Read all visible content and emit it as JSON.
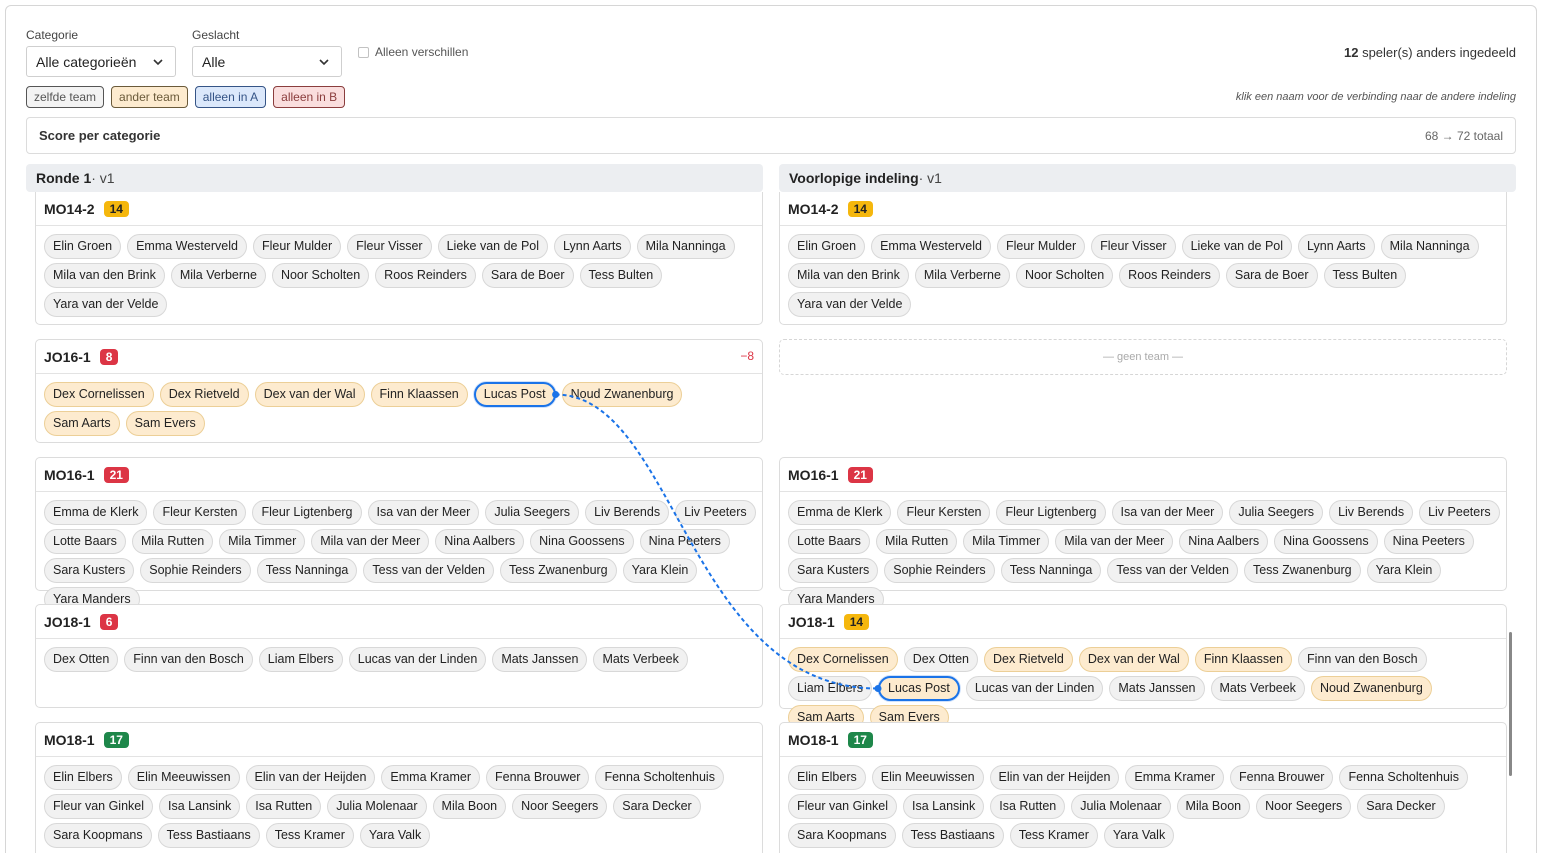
{
  "filters": {
    "category_label": "Categorie",
    "category_value": "Alle categorieën",
    "gender_label": "Geslacht",
    "gender_value": "Alle",
    "only_diff_label": "Alleen verschillen"
  },
  "summary": {
    "count": "12",
    "text": "speler(s) anders ingedeeld"
  },
  "legend": {
    "same": "zelfde team",
    "other": "ander team",
    "only_a": "alleen in A",
    "only_b": "alleen in B"
  },
  "hint": "klik een naam voor de verbinding naar de andere indeling",
  "score": {
    "title": "Score per categorie",
    "total": "68 → 72 totaal"
  },
  "colors": {
    "moved": "#fdebcf",
    "selected": "#1a73e8",
    "yellow": "#f5b70d",
    "red": "#dc3545",
    "green": "#1e874a"
  },
  "left": {
    "title": "Ronde 1",
    "version": " · v1",
    "mo14": {
      "name": "MO14-2",
      "score": "14",
      "players": [
        "Elin Groen",
        "Emma Westerveld",
        "Fleur Mulder",
        "Fleur Visser",
        "Lieke van de Pol",
        "Lynn Aarts",
        "Mila Nanninga",
        "Mila van den Brink",
        "Mila Verberne",
        "Noor Scholten",
        "Roos Reinders",
        "Sara de Boer",
        "Tess Bulten",
        "Yara van der Velde"
      ]
    },
    "jo16": {
      "name": "JO16-1",
      "score": "8",
      "delta": "−8",
      "players": [
        "Dex Cornelissen",
        "Dex Rietveld",
        "Dex van der Wal",
        "Finn Klaassen",
        "Lucas Post",
        "Noud Zwanenburg",
        "Sam Aarts",
        "Sam Evers"
      ]
    },
    "mo16": {
      "name": "MO16-1",
      "score": "21",
      "players": [
        "Emma de Klerk",
        "Fleur Kersten",
        "Fleur Ligtenberg",
        "Isa van der Meer",
        "Julia Seegers",
        "Liv Berends",
        "Liv Peeters",
        "Lotte Baars",
        "Mila Rutten",
        "Mila Timmer",
        "Mila van der Meer",
        "Nina Aalbers",
        "Nina Goossens",
        "Nina Peeters",
        "Sara Kusters",
        "Sophie Reinders",
        "Tess Nanninga",
        "Tess van der Velden",
        "Tess Zwanenburg",
        "Yara Klein",
        "Yara Manders"
      ]
    },
    "jo18": {
      "name": "JO18-1",
      "score": "6",
      "players": [
        "Dex Otten",
        "Finn van den Bosch",
        "Liam Elbers",
        "Lucas van der Linden",
        "Mats Janssen",
        "Mats Verbeek"
      ]
    },
    "mo18": {
      "name": "MO18-1",
      "score": "17",
      "players": [
        "Elin Elbers",
        "Elin Meeuwissen",
        "Elin van der Heijden",
        "Emma Kramer",
        "Fenna Brouwer",
        "Fenna Scholtenhuis",
        "Fleur van Ginkel",
        "Isa Lansink",
        "Isa Rutten",
        "Julia Molenaar",
        "Mila Boon",
        "Noor Seegers",
        "Sara Decker",
        "Sara Koopmans",
        "Tess Bastiaans",
        "Tess Kramer",
        "Yara Valk"
      ]
    }
  },
  "right": {
    "title": "Voorlopige indeling",
    "version": " · v1",
    "empty_text": "— geen team —",
    "mo14": {
      "name": "MO14-2",
      "score": "14",
      "players": [
        "Elin Groen",
        "Emma Westerveld",
        "Fleur Mulder",
        "Fleur Visser",
        "Lieke van de Pol",
        "Lynn Aarts",
        "Mila Nanninga",
        "Mila van den Brink",
        "Mila Verberne",
        "Noor Scholten",
        "Roos Reinders",
        "Sara de Boer",
        "Tess Bulten",
        "Yara van der Velde"
      ]
    },
    "mo16": {
      "name": "MO16-1",
      "score": "21",
      "players": [
        "Emma de Klerk",
        "Fleur Kersten",
        "Fleur Ligtenberg",
        "Isa van der Meer",
        "Julia Seegers",
        "Liv Berends",
        "Liv Peeters",
        "Lotte Baars",
        "Mila Rutten",
        "Mila Timmer",
        "Mila van der Meer",
        "Nina Aalbers",
        "Nina Goossens",
        "Nina Peeters",
        "Sara Kusters",
        "Sophie Reinders",
        "Tess Nanninga",
        "Tess van der Velden",
        "Tess Zwanenburg",
        "Yara Klein",
        "Yara Manders"
      ]
    },
    "jo18": {
      "name": "JO18-1",
      "score": "14",
      "players": [
        "Dex Cornelissen",
        "Dex Otten",
        "Dex Rietveld",
        "Dex van der Wal",
        "Finn Klaassen",
        "Finn van den Bosch",
        "Liam Elbers",
        "Lucas Post",
        "Lucas van der Linden",
        "Mats Janssen",
        "Mats Verbeek",
        "Noud Zwanenburg",
        "Sam Aarts",
        "Sam Evers"
      ],
      "moved": [
        "Dex Cornelissen",
        "Dex Rietveld",
        "Dex van der Wal",
        "Finn Klaassen",
        "Lucas Post",
        "Noud Zwanenburg",
        "Sam Aarts",
        "Sam Evers"
      ]
    },
    "mo18": {
      "name": "MO18-1",
      "score": "17",
      "players": [
        "Elin Elbers",
        "Elin Meeuwissen",
        "Elin van der Heijden",
        "Emma Kramer",
        "Fenna Brouwer",
        "Fenna Scholtenhuis",
        "Fleur van Ginkel",
        "Isa Lansink",
        "Isa Rutten",
        "Julia Molenaar",
        "Mila Boon",
        "Noor Seegers",
        "Sara Decker",
        "Sara Koopmans",
        "Tess Bastiaans",
        "Tess Kramer",
        "Yara Valk"
      ]
    }
  },
  "selected_player": "Lucas Post"
}
